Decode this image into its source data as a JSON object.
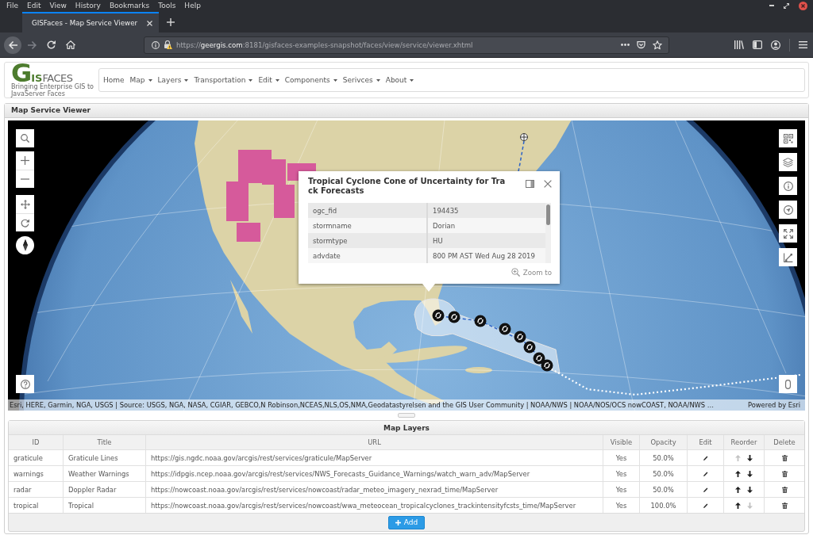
{
  "browser": {
    "menu": [
      "File",
      "Edit",
      "View",
      "History",
      "Bookmarks",
      "Tools",
      "Help"
    ],
    "tabs": [
      {
        "title": "GISFaces - Map Service Viewer",
        "selected": true
      }
    ],
    "navigation": {
      "back_disabled": false,
      "forward_disabled": true
    },
    "address": {
      "scheme": "https://",
      "host": "geergis.com",
      "path": ":8181/gisfaces-examples-snapshot/faces/view/service/viewer.xhtml"
    }
  },
  "header": {
    "logo": {
      "lead": "G",
      "accent": "IS",
      "rest": "FACES",
      "tagline": "Bringing Enterprise GIS to JavaServer Faces"
    },
    "menu": [
      {
        "label": "Home",
        "dropdown": false
      },
      {
        "label": "Map",
        "dropdown": true
      },
      {
        "label": "Layers",
        "dropdown": true
      },
      {
        "label": "Transportation",
        "dropdown": true
      },
      {
        "label": "Edit",
        "dropdown": true
      },
      {
        "label": "Components",
        "dropdown": true
      },
      {
        "label": "Serivces",
        "dropdown": true
      },
      {
        "label": "About",
        "dropdown": true
      }
    ]
  },
  "map_panel": {
    "title": "Map Service Viewer",
    "popup": {
      "title": "Tropical Cyclone Cone of Uncertainty for Track Forecasts",
      "fields": [
        {
          "name": "ogc_fid",
          "value": "194435"
        },
        {
          "name": "stormname",
          "value": "Dorian"
        },
        {
          "name": "stormtype",
          "value": "HU"
        },
        {
          "name": "advdate",
          "value": "800 PM AST Wed Aug 28 2019"
        }
      ],
      "action": "Zoom to"
    },
    "attribution": {
      "sources": "Esri, HERE, Garmin, NGA, USGS | Source: USGS, NGA, NASA, CGIAR, GEBCO,N Robinson,NCEAS,NLS,OS,NMA,Geodatastyrelsen and the GIS User Community | NOAA/NWS | NOAA/NOS/OCS nowCOAST, NOAA/NWS …",
      "powered_by": "Powered by Esri"
    }
  },
  "layers": {
    "title": "Map Layers",
    "columns": [
      "ID",
      "Title",
      "URL",
      "Visible",
      "Opacity",
      "Edit",
      "Reorder",
      "Delete"
    ],
    "rows": [
      {
        "id": "graticule",
        "title": "Graticule Lines",
        "url": "https://gis.ngdc.noaa.gov/arcgis/rest/services/graticule/MapServer",
        "visible": "Yes",
        "opacity": "50.0%",
        "up_disabled": true,
        "down_disabled": false
      },
      {
        "id": "warnings",
        "title": "Weather Warnings",
        "url": "https://idpgis.ncep.noaa.gov/arcgis/rest/services/NWS_Forecasts_Guidance_Warnings/watch_warn_adv/MapServer",
        "visible": "Yes",
        "opacity": "50.0%",
        "up_disabled": false,
        "down_disabled": false
      },
      {
        "id": "radar",
        "title": "Doppler Radar",
        "url": "https://nowcoast.noaa.gov/arcgis/rest/services/nowcoast/radar_meteo_imagery_nexrad_time/MapServer",
        "visible": "Yes",
        "opacity": "50.0%",
        "up_disabled": false,
        "down_disabled": false
      },
      {
        "id": "tropical",
        "title": "Tropical",
        "url": "https://nowcoast.noaa.gov/arcgis/rest/services/nowcoast/wwa_meteocean_tropicalcyclones_trackintensityfcsts_time/MapServer",
        "visible": "Yes",
        "opacity": "100.0%",
        "up_disabled": false,
        "down_disabled": true
      }
    ],
    "add_button": "Add"
  }
}
